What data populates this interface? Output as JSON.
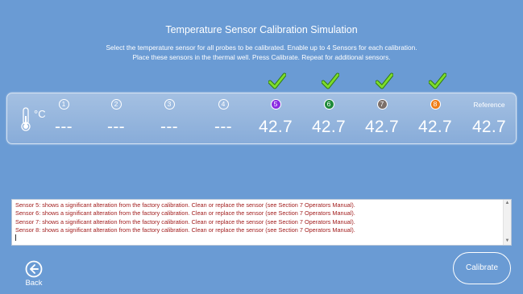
{
  "header": {
    "title": "Temperature Sensor Calibration Simulation",
    "instructions_line1": "Select the temperature sensor for all probes to be calibrated.  Enable up to 4 Sensors for each calibration.",
    "instructions_line2": "Place these sensors in the thermal well.  Press Calibrate.  Repeat for additional sensors."
  },
  "panel": {
    "unit_label": "°C",
    "sensors": [
      {
        "number": "1",
        "value": "---",
        "checked": false,
        "color": "transparent"
      },
      {
        "number": "2",
        "value": "---",
        "checked": false,
        "color": "transparent"
      },
      {
        "number": "3",
        "value": "---",
        "checked": false,
        "color": "transparent"
      },
      {
        "number": "4",
        "value": "---",
        "checked": false,
        "color": "transparent"
      },
      {
        "number": "5",
        "value": "42.7",
        "checked": true,
        "color": "#8a2be2"
      },
      {
        "number": "6",
        "value": "42.7",
        "checked": true,
        "color": "#1e8a3a"
      },
      {
        "number": "7",
        "value": "42.7",
        "checked": true,
        "color": "#7b6f6a"
      },
      {
        "number": "8",
        "value": "42.7",
        "checked": true,
        "color": "#ef7d18"
      }
    ],
    "reference": {
      "label": "Reference",
      "value": "42.7"
    }
  },
  "log": {
    "lines": [
      "Sensor 5: shows a significant alteration from the factory calibration.  Clean or replace the sensor (see Section 7 Operators Manual).",
      "Sensor 6: shows a significant alteration from the factory calibration.  Clean or replace the sensor (see Section 7 Operators Manual).",
      "Sensor 7: shows a significant alteration from the factory calibration.  Clean or replace the sensor (see Section 7 Operators Manual).",
      "Sensor 8: shows a significant alteration from the factory calibration.  Clean or replace the sensor (see Section 7 Operators Manual)."
    ]
  },
  "footer": {
    "back_label": "Back",
    "calibrate_label": "Calibrate"
  },
  "colors": {
    "background": "#6a9bd4",
    "check": "#7ddc2c",
    "log_text": "#a11c1c"
  }
}
